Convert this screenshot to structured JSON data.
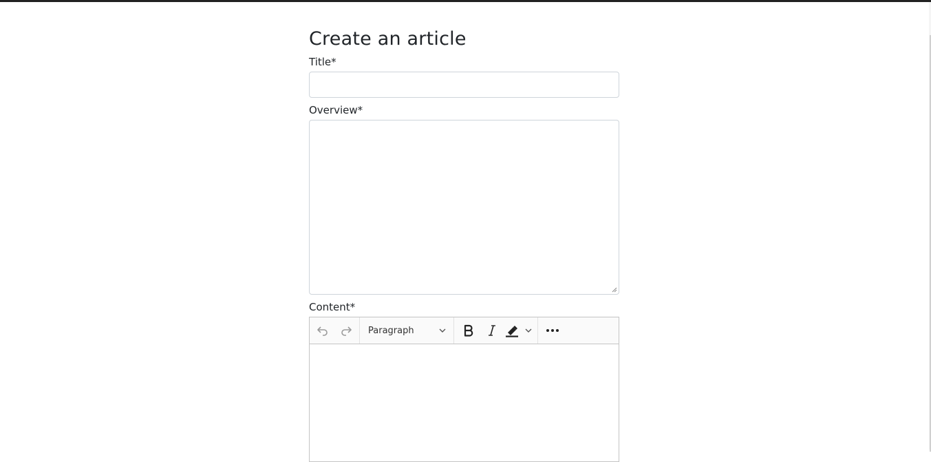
{
  "page": {
    "heading": "Create an article"
  },
  "form": {
    "title_label": "Title*",
    "title_value": "",
    "overview_label": "Overview*",
    "overview_value": "",
    "content_label": "Content*"
  },
  "editor": {
    "heading_select": "Paragraph",
    "toolbar_icons": [
      "undo-icon",
      "redo-icon",
      "bold-icon",
      "italic-icon",
      "highlighter-icon",
      "chevron-down-icon",
      "more-icon"
    ],
    "content": ""
  },
  "colors": {
    "top_bar": "#222222",
    "border": "#ced4da",
    "editor_border": "#c4c4c4"
  }
}
